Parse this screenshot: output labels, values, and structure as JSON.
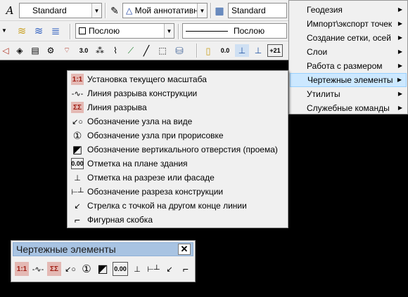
{
  "toolbar_row1": {
    "text_style_value": "Standard",
    "annotative_value": "Мой аннотативн",
    "table_style_value": "Standard"
  },
  "toolbar_row2": {
    "color_value": "Послою",
    "linetype_value": "Послою"
  },
  "toolbar_row3": {
    "zero_label": "0.0",
    "plus_label": "+21"
  },
  "main_menu": {
    "items": [
      {
        "label": "Геодезия",
        "has_submenu": true
      },
      {
        "label": "Импорт\\экспорт точек",
        "has_submenu": true
      },
      {
        "label": "Создание сетки, осей",
        "has_submenu": true
      },
      {
        "label": "Слои",
        "has_submenu": true
      },
      {
        "label": "Работа с размером",
        "has_submenu": true
      },
      {
        "label": "Чертежные элементы",
        "has_submenu": true,
        "selected": true
      },
      {
        "label": "Утилиты",
        "has_submenu": true
      },
      {
        "label": "Служебные команды",
        "has_submenu": true
      }
    ]
  },
  "submenu": {
    "items": [
      {
        "label": "Установка текущего масштаба",
        "icon": "scale-icon",
        "glyph": "1:1"
      },
      {
        "label": "Линия разрыва конструкции",
        "icon": "break-line-icon",
        "glyph": "-∿-"
      },
      {
        "label": "Линия разрыва",
        "icon": "break-icon",
        "glyph": "ΣΣ"
      },
      {
        "label": "Обозначение узла на виде",
        "icon": "node-view-icon",
        "glyph": "↙○"
      },
      {
        "label": "Обозначение узла при прорисовке",
        "icon": "node-draw-icon",
        "glyph": "①"
      },
      {
        "label": "Обозначение вертикального отверстия (проема)",
        "icon": "opening-icon",
        "glyph": "◩"
      },
      {
        "label": "Отметка на плане здания",
        "icon": "plan-mark-icon",
        "glyph": "0.00"
      },
      {
        "label": "Отметка на разрезе или фасаде",
        "icon": "section-mark-icon",
        "glyph": "⊥"
      },
      {
        "label": "Обозначение разреза конструкции",
        "icon": "section-cut-icon",
        "glyph": "⊢┴"
      },
      {
        "label": "Стрелка с точкой на другом конце линии",
        "icon": "arrow-dot-icon",
        "glyph": "↙"
      },
      {
        "label": "Фигурная скобка",
        "icon": "brace-icon",
        "glyph": "⌐"
      }
    ]
  },
  "floating_toolbar": {
    "title": "Чертежные элементы",
    "close_glyph": "✕",
    "buttons": [
      {
        "name": "scale-icon",
        "glyph": "1:1"
      },
      {
        "name": "break-line-icon",
        "glyph": "-∿-"
      },
      {
        "name": "break-icon",
        "glyph": "ΣΣ"
      },
      {
        "name": "node-view-icon",
        "glyph": "↙○"
      },
      {
        "name": "node-draw-icon",
        "glyph": "①"
      },
      {
        "name": "opening-icon",
        "glyph": "◩"
      },
      {
        "name": "plan-mark-icon",
        "glyph": "0.00"
      },
      {
        "name": "section-mark-icon",
        "glyph": "⊥"
      },
      {
        "name": "section-cut-icon",
        "glyph": "⊢┴"
      },
      {
        "name": "arrow-dot-icon",
        "glyph": "↙"
      },
      {
        "name": "brace-icon",
        "glyph": "⌐"
      }
    ]
  },
  "colors": {
    "background": "#000000",
    "menu_bg": "#f0f0f0",
    "menu_highlight": "#cce8ff",
    "toolbar_title_bg": "#a8c3e2",
    "scale_icon_bg": "#e4b9b4"
  }
}
